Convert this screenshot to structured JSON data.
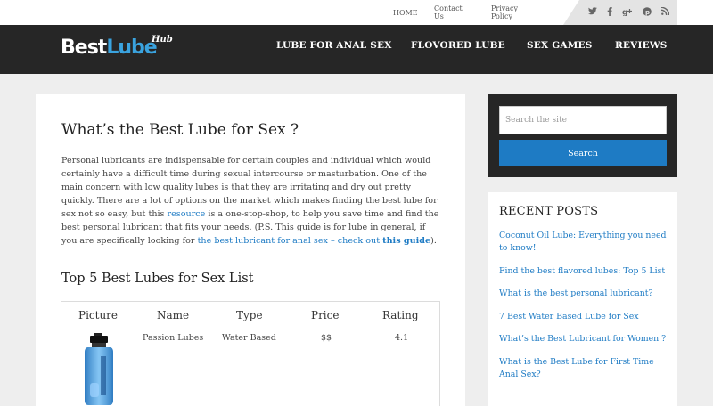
{
  "topbar": {
    "links": [
      "HOME",
      "Contact Us",
      "Privacy Policy"
    ],
    "social_icons": [
      "twitter-icon",
      "facebook-icon",
      "google-plus-icon",
      "pinterest-icon",
      "rss-icon"
    ]
  },
  "header": {
    "logo": {
      "part1": "Best",
      "part2": "Lube",
      "part3": "Hub"
    },
    "nav": [
      "LUBE FOR ANAL SEX",
      "FLOVORED LUBE",
      "SEX GAMES",
      "REVIEWS"
    ]
  },
  "article": {
    "title": "What’s the Best Lube for Sex ?",
    "intro_1": "Personal lubricants are indispensable for certain couples and individual which would certainly have a difficult time during sexual intercourse or masturbation. One of the main concern with low quality lubes is that they are irritating and dry out pretty quickly. There are a lot of options on the market which makes finding the best lube for sex not so easy, but this ",
    "intro_link_1": "resource",
    "intro_2": "  is a one-stop-shop, to help you save time and find the best personal lubricant that fits your needs. (P.S. This guide is for lube in general, if you are specifically looking for ",
    "intro_link_2": "the best lubricant for anal sex – check out ",
    "intro_link_3": "this guide",
    "intro_3": ").",
    "list_title": "Top 5 Best Lubes for Sex List"
  },
  "table": {
    "headers": [
      "Picture",
      "Name",
      "Type",
      "Price",
      "Rating"
    ],
    "rows": [
      {
        "name": "Passion Lubes",
        "type": "Water Based",
        "price": "$$",
        "rating": "4.1"
      }
    ]
  },
  "sidebar": {
    "search_placeholder": "Search the site",
    "search_button": "Search",
    "recent_title": "RECENT POSTS",
    "recent_posts": [
      "Coconut Oil Lube: Everything you need to know!",
      "Find the best flavored lubes: Top 5 List",
      "What is the best personal lubricant?",
      "7 Best Water Based Lube for Sex",
      "What’s the Best Lubricant for Women ?",
      "What is the Best Lube for First Time Anal Sex?"
    ]
  }
}
